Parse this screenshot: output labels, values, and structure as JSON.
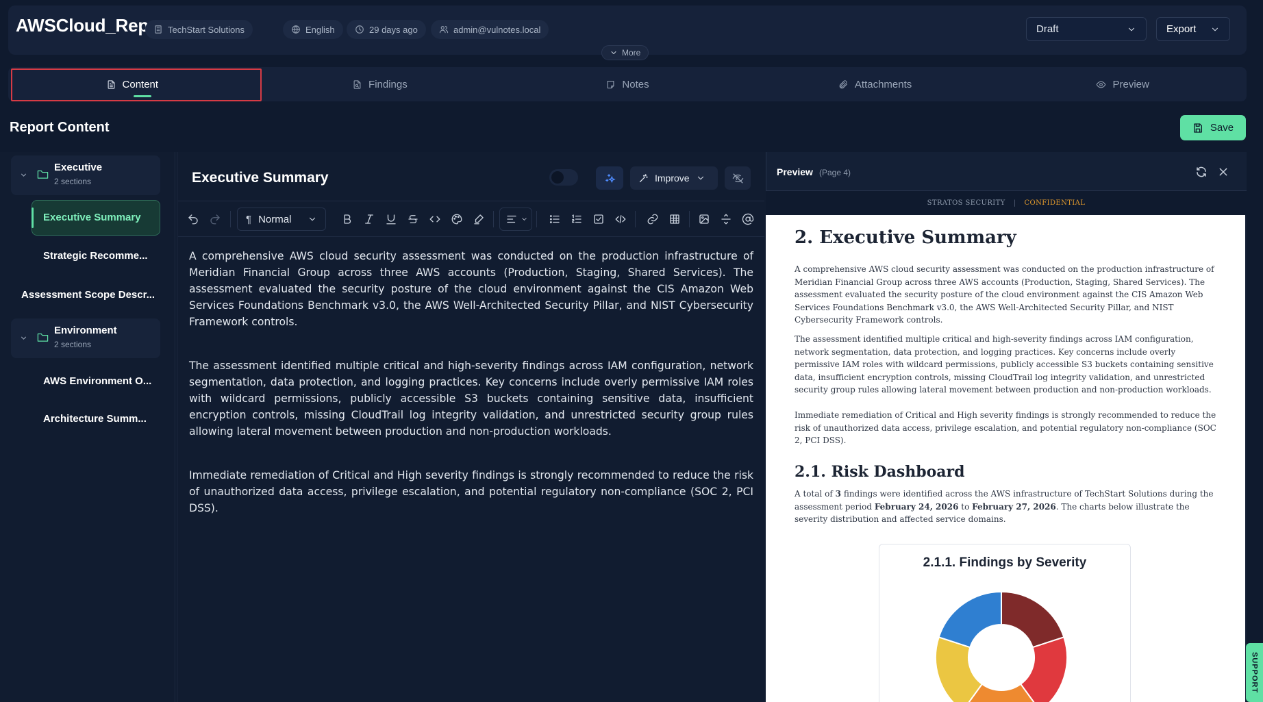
{
  "header": {
    "title": "AWSCloud_Report",
    "chips": {
      "company": "TechStart Solutions",
      "language": "English",
      "updated": "29 days ago",
      "user": "admin@vulnotes.local"
    },
    "status_value": "Draft",
    "export_label": "Export",
    "more_label": "More"
  },
  "tabs": [
    {
      "label": "Content",
      "icon": "file-text-icon",
      "active": true
    },
    {
      "label": "Findings",
      "icon": "file-search-icon",
      "active": false
    },
    {
      "label": "Notes",
      "icon": "note-icon",
      "active": false
    },
    {
      "label": "Attachments",
      "icon": "paperclip-icon",
      "active": false
    },
    {
      "label": "Preview",
      "icon": "eye-icon",
      "active": false
    }
  ],
  "section_heading": "Report Content",
  "save_label": "Save",
  "sidebar": {
    "groups": [
      {
        "title": "Executive",
        "subtitle": "2 sections"
      },
      {
        "title": "Environment",
        "subtitle": "2 sections"
      }
    ],
    "items": {
      "executive_summary": "Executive Summary",
      "strategic": "Strategic Recomme...",
      "scope": "Assessment Scope Descr...",
      "aws_env": "AWS Environment O...",
      "architecture": "Architecture Summ..."
    }
  },
  "editor": {
    "title": "Executive Summary",
    "improve_label": "Improve",
    "paragraph_style": "Normal",
    "paragraphs": [
      "A comprehensive AWS cloud security assessment was conducted on the production infrastructure of Meridian Financial Group across three AWS accounts (Production, Staging, Shared Services). The assessment evaluated the security posture of the cloud environment against the CIS Amazon Web Services Foundations Benchmark v3.0, the AWS Well-Architected Security Pillar, and NIST Cybersecurity Framework controls.",
      "The assessment identified multiple critical and high-severity findings across IAM configuration, network segmentation, data protection, and logging practices. Key concerns include overly permissive IAM roles with wildcard permissions, publicly accessible S3 buckets containing sensitive data, insufficient encryption controls, missing CloudTrail log integrity validation, and unrestricted security group rules allowing lateral movement between production and non-production workloads.",
      "Immediate remediation of Critical and High severity findings is strongly recommended to reduce the risk of unauthorized data access, privilege escalation, and potential regulatory non-compliance (SOC 2, PCI DSS)."
    ]
  },
  "preview": {
    "title": "Preview",
    "page_label": "(Page 4)",
    "brand": "STRATOS SECURITY",
    "band_separator": "|",
    "classification": "CONFIDENTIAL",
    "heading": "2. Executive Summary",
    "paragraphs": [
      "A comprehensive AWS cloud security assessment was conducted on the production infrastructure of Meridian Financial Group across three AWS accounts (Production, Staging, Shared Services). The assessment evaluated the security posture of the cloud environment against the CIS Amazon Web Services Foundations Benchmark v3.0, the AWS Well-Architected Security Pillar, and NIST Cybersecurity Framework controls.",
      "The assessment identified multiple critical and high-severity findings across IAM configuration, network segmentation, data protection, and logging practices. Key concerns include overly permissive IAM roles with wildcard permissions, publicly accessible S3 buckets containing sensitive data, insufficient encryption controls, missing CloudTrail log integrity validation, and unrestricted security group rules allowing lateral movement between production and non-production workloads.",
      "Immediate remediation of Critical and High severity findings is strongly recommended to reduce the risk of unauthorized data access, privilege escalation, and potential regulatory non-compliance (SOC 2, PCI DSS)."
    ],
    "subheading": "2.1. Risk Dashboard",
    "dashboard_text": {
      "a": "A total of ",
      "count": "3",
      "b": " findings were identified across the AWS infrastructure of TechStart Solutions during the assessment period ",
      "start": "February 24, 2026",
      "c": " to ",
      "end": "February 27, 2026",
      "d": ". The charts below illustrate the severity distribution and affected service domains."
    },
    "chart_title": "2.1.1. Findings by Severity"
  },
  "chart_data": {
    "type": "pie",
    "title": "2.1.1. Findings by Severity",
    "donut": true,
    "slices": [
      {
        "value": 1,
        "color": "#7f2a2a"
      },
      {
        "value": 1,
        "color": "#e0393e"
      },
      {
        "value": 1,
        "color": "#ee8a30"
      },
      {
        "value": 1,
        "color": "#ebc642"
      },
      {
        "value": 1,
        "color": "#2f7fd1"
      }
    ]
  },
  "support_label": "SUPPORT",
  "colors": {
    "accent": "#5fe0a4",
    "background": "#0f1a2e",
    "panel": "#16223a",
    "confidential": "#e39b2d"
  }
}
